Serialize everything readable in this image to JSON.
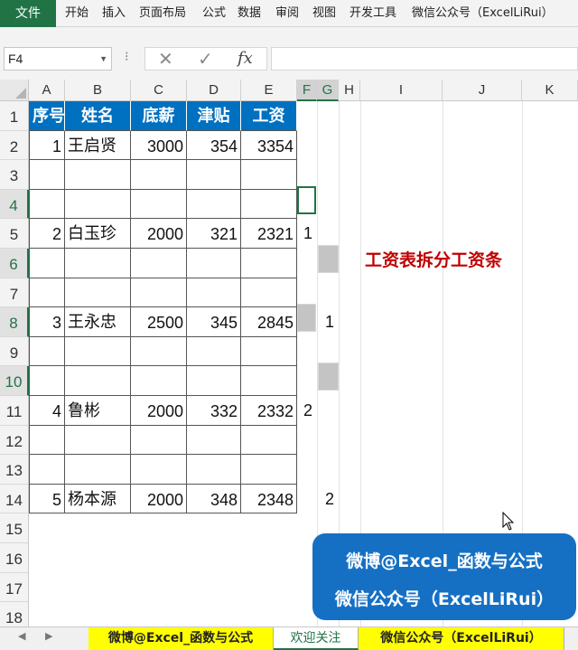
{
  "ribbon": {
    "file_tab": "文件",
    "tabs": [
      "开始",
      "插入",
      "页面布局",
      "公式",
      "数据",
      "审阅",
      "视图",
      "开发工具",
      "微信公众号（ExcelLiRui）"
    ]
  },
  "formula_bar": {
    "name_box": "F4",
    "dots": "⁝",
    "cancel_glyph": "✕",
    "enter_glyph": "✓",
    "fx_label": "fx",
    "formula": ""
  },
  "columns": [
    "A",
    "B",
    "C",
    "D",
    "E",
    "F",
    "G",
    "H",
    "I",
    "J",
    "K"
  ],
  "selected_columns": [
    "F",
    "G"
  ],
  "rows": [
    "1",
    "2",
    "3",
    "4",
    "5",
    "6",
    "7",
    "8",
    "9",
    "10",
    "11",
    "12",
    "13",
    "14",
    "15",
    "16",
    "17",
    "18"
  ],
  "selected_rows": [
    "4",
    "6",
    "8",
    "10"
  ],
  "table": {
    "headers": [
      "序号",
      "姓名",
      "底薪",
      "津贴",
      "工资"
    ],
    "records": [
      {
        "row": 2,
        "values": [
          "1",
          "王启贤",
          "3000",
          "354",
          "3354"
        ]
      },
      {
        "row": 5,
        "values": [
          "2",
          "白玉珍",
          "2000",
          "321",
          "2321"
        ]
      },
      {
        "row": 8,
        "values": [
          "3",
          "王永忠",
          "2500",
          "345",
          "2845"
        ]
      },
      {
        "row": 11,
        "values": [
          "4",
          "鲁彬",
          "2000",
          "332",
          "2332"
        ]
      },
      {
        "row": 14,
        "values": [
          "5",
          "杨本源",
          "2000",
          "348",
          "2348"
        ]
      }
    ],
    "helper_numbers": [
      {
        "row": 5,
        "col": "F",
        "value": "1"
      },
      {
        "row": 8,
        "col": "G",
        "value": "1"
      },
      {
        "row": 11,
        "col": "F",
        "value": "2"
      },
      {
        "row": 14,
        "col": "G",
        "value": "2"
      }
    ]
  },
  "annotation": "工资表拆分工资条",
  "watermark": {
    "line1": "微博@Excel_函数与公式",
    "line2": "微信公众号（ExcelLiRui）"
  },
  "sheet_tabs": [
    "微博@Excel_函数与公式",
    "欢迎关注",
    "微信公众号（ExcelLiRui）"
  ],
  "active_sheet": "欢迎关注",
  "colors": {
    "excel_green": "#217346",
    "header_fill": "#0070c0",
    "annotation_red": "#c00000",
    "watermark_blue": "#1570c4",
    "tab_yellow": "#ffff00"
  }
}
